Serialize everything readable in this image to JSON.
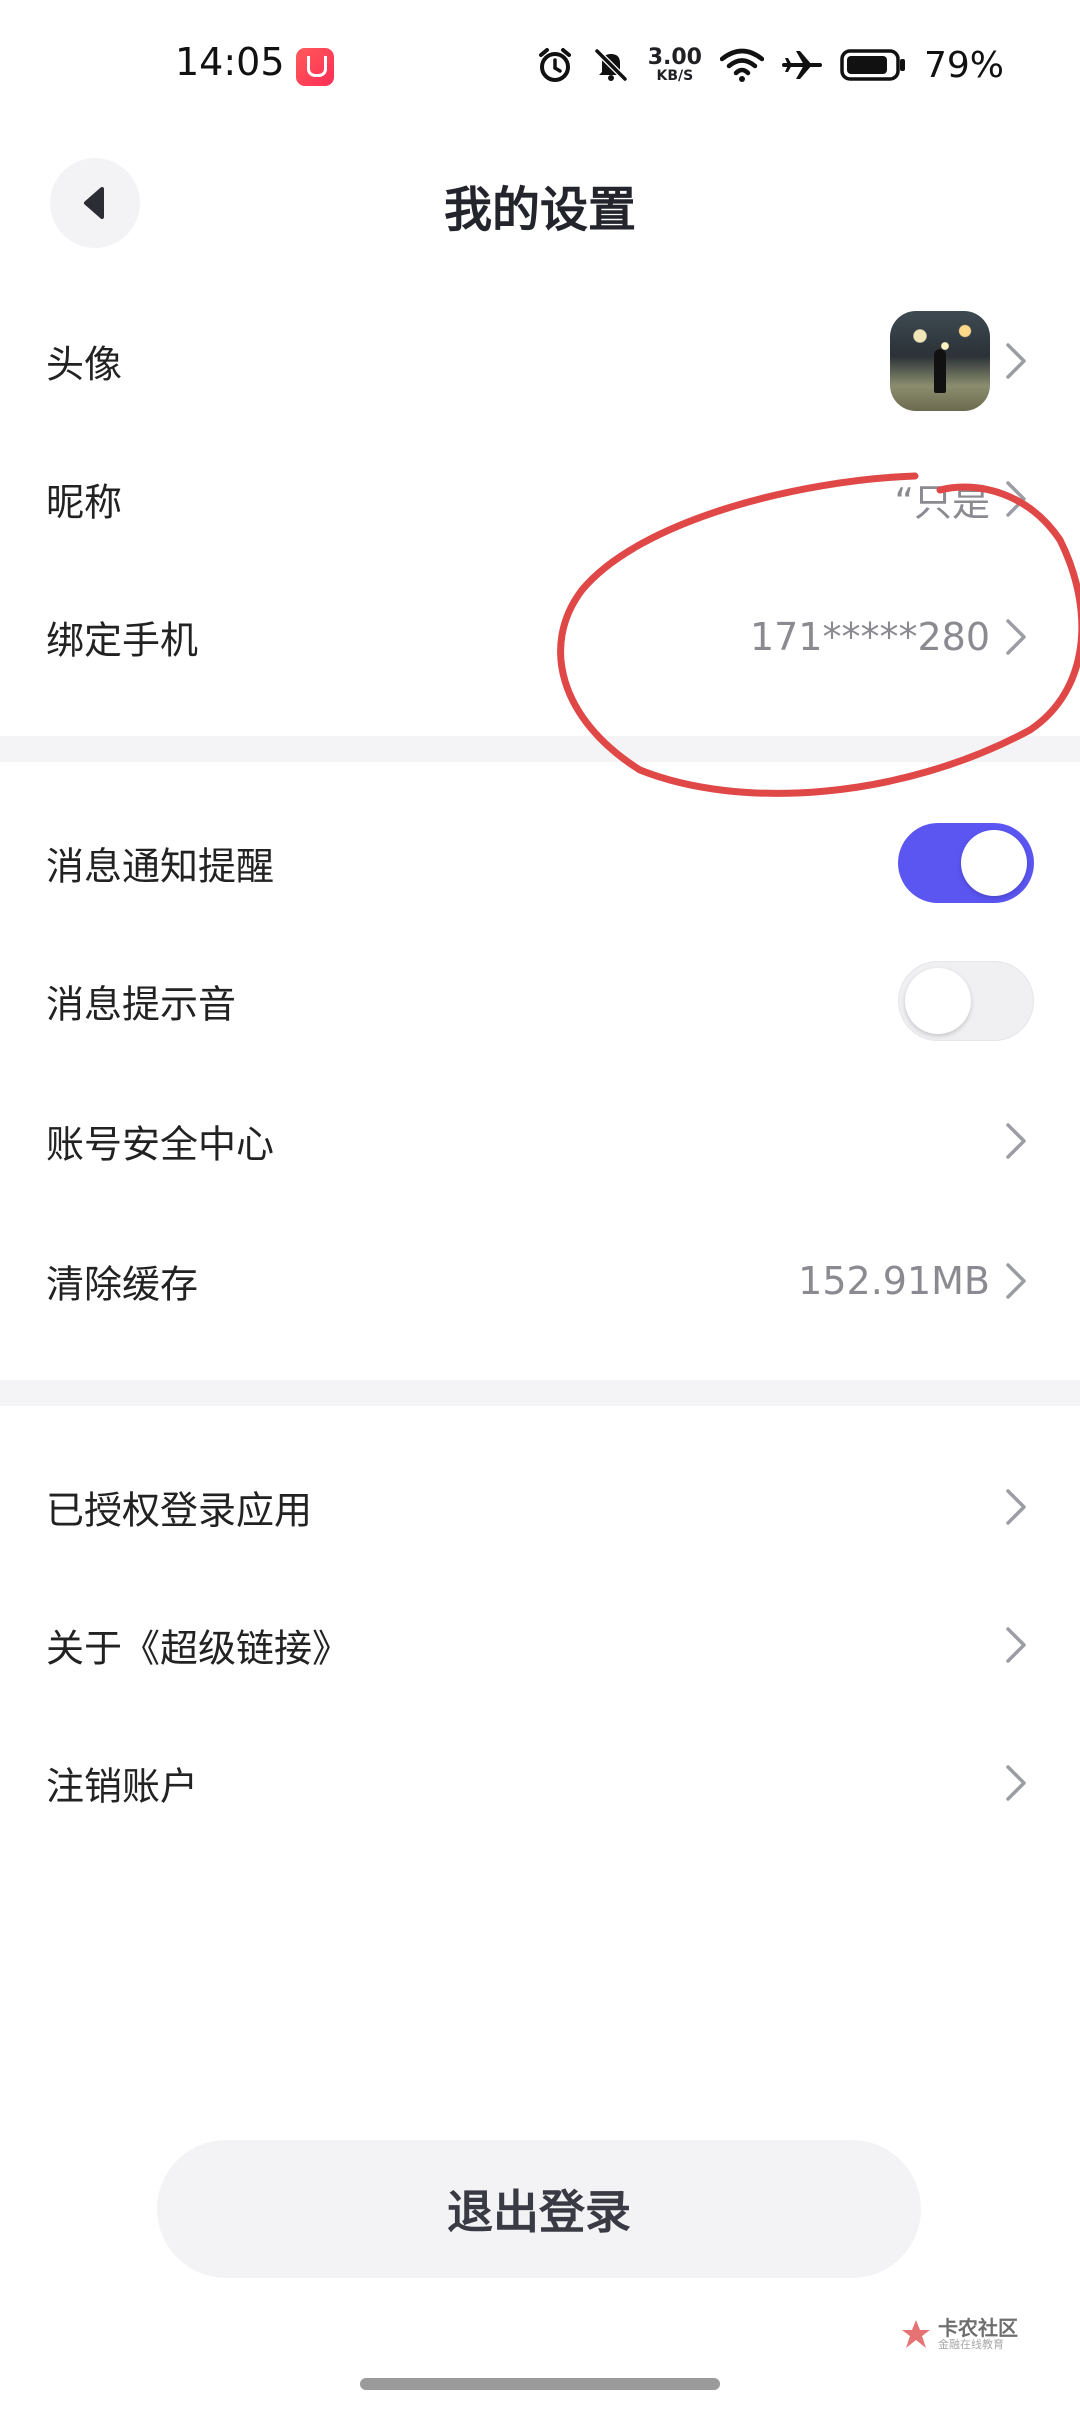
{
  "status_bar": {
    "time": "14:05",
    "app_badge_icon": "app-notification-icon",
    "net_speed_value": "3.00",
    "net_speed_unit": "KB/S",
    "battery_percent": "79%",
    "icons": [
      "alarm-icon",
      "mute-bell-icon",
      "wifi-icon",
      "airplane-icon",
      "battery-icon"
    ]
  },
  "header": {
    "title": "我的设置",
    "back_icon": "back-arrow-icon"
  },
  "profile_section": [
    {
      "label": "头像",
      "value": ""
    },
    {
      "label": "昵称",
      "value": "“只是"
    },
    {
      "label": "绑定手机",
      "value": "171*****280"
    }
  ],
  "settings_section": {
    "notify": {
      "label": "消息通知提醒",
      "on": true
    },
    "sound": {
      "label": "消息提示音",
      "on": false
    },
    "security": {
      "label": "账号安全中心"
    },
    "cache": {
      "label": "清除缓存",
      "value": "152.91MB"
    }
  },
  "misc_section": [
    {
      "label": "已授权登录应用"
    },
    {
      "label": "关于《超级链接》"
    },
    {
      "label": "注销账户"
    }
  ],
  "logout_label": "退出登录",
  "watermark": {
    "title": "卡农社区",
    "subtitle": "金融在线教育"
  },
  "colors": {
    "accent": "#5b55f2",
    "annotation": "#e04848",
    "divider": "#f4f4f6"
  }
}
